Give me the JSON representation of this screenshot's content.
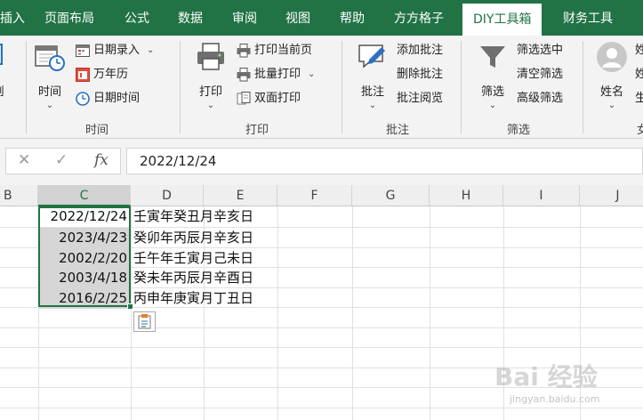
{
  "ribbon_tabs": [
    "插入",
    "页面布局",
    "公式",
    "数据",
    "审阅",
    "视图",
    "帮助",
    "方方格子",
    "DIY工具箱",
    "财务工具"
  ],
  "active_tab": "DIY工具箱",
  "colors": {
    "excel_green": "#217346",
    "selection_fill": "#d6d6d6"
  },
  "groups": {
    "time": {
      "label": "时间",
      "big_button": "时间",
      "items": [
        "日期录入",
        "万年历",
        "日期时间"
      ]
    },
    "print": {
      "label": "打印",
      "big_button": "打印",
      "items": [
        "打印当前页",
        "批量打印",
        "双面打印"
      ]
    },
    "comment": {
      "label": "批注",
      "big_button": "批注",
      "items": [
        "添加批注",
        "删除批注",
        "批注阅览"
      ]
    },
    "filter": {
      "label": "筛选",
      "big_button": "筛选",
      "items": [
        "筛选选中",
        "清空筛选",
        "高级筛选"
      ]
    },
    "name": {
      "big_button": "姓名",
      "partial_chars": [
        "姓",
        "姓",
        "生"
      ],
      "partial_label": "女"
    },
    "left_partial": {
      "label": "副"
    }
  },
  "formula_bar": {
    "cancel_icon": "✕",
    "enter_icon": "✓",
    "fx_icon": "fx",
    "value": "2022/12/24"
  },
  "columns": [
    "B",
    "C",
    "D",
    "E",
    "F",
    "G",
    "H",
    "I",
    "J"
  ],
  "selected_column": "C",
  "rows": [
    {
      "date": "2022/12/24",
      "ganzhi": "壬寅年癸丑月辛亥日"
    },
    {
      "date": "2023/4/23",
      "ganzhi": "癸卯年丙辰月辛亥日"
    },
    {
      "date": "2002/2/20",
      "ganzhi": "壬午年壬寅月己未日"
    },
    {
      "date": "2003/4/18",
      "ganzhi": "癸未年丙辰月辛酉日"
    },
    {
      "date": "2016/2/25",
      "ganzhi": "丙申年庚寅月丁丑日"
    }
  ],
  "watermark": {
    "brand": "Bai 经验",
    "url": "jingyan.baidu.com"
  }
}
